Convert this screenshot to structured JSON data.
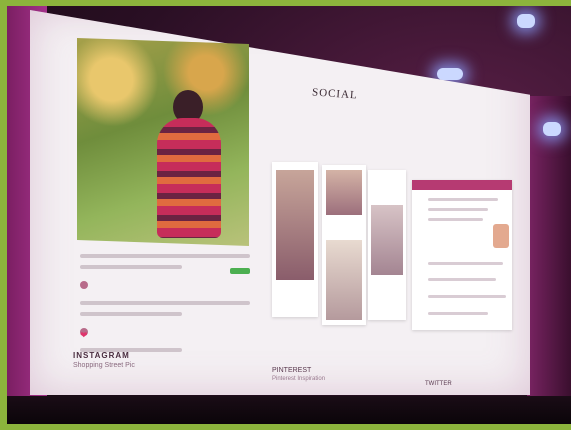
{
  "slide": {
    "title": "SOCIAL",
    "instagram": {
      "label": "INSTAGRAM",
      "sub": "Shopping Street Pic"
    },
    "pinterest": {
      "label": "PINTEREST",
      "sub": "Pinterest Inspiration"
    },
    "twitter": {
      "label": "TWITTER",
      "sub": ""
    }
  },
  "colors": {
    "frame": "#8cb43c",
    "screen": "#f4f0f3",
    "accent": "#b63a72"
  }
}
